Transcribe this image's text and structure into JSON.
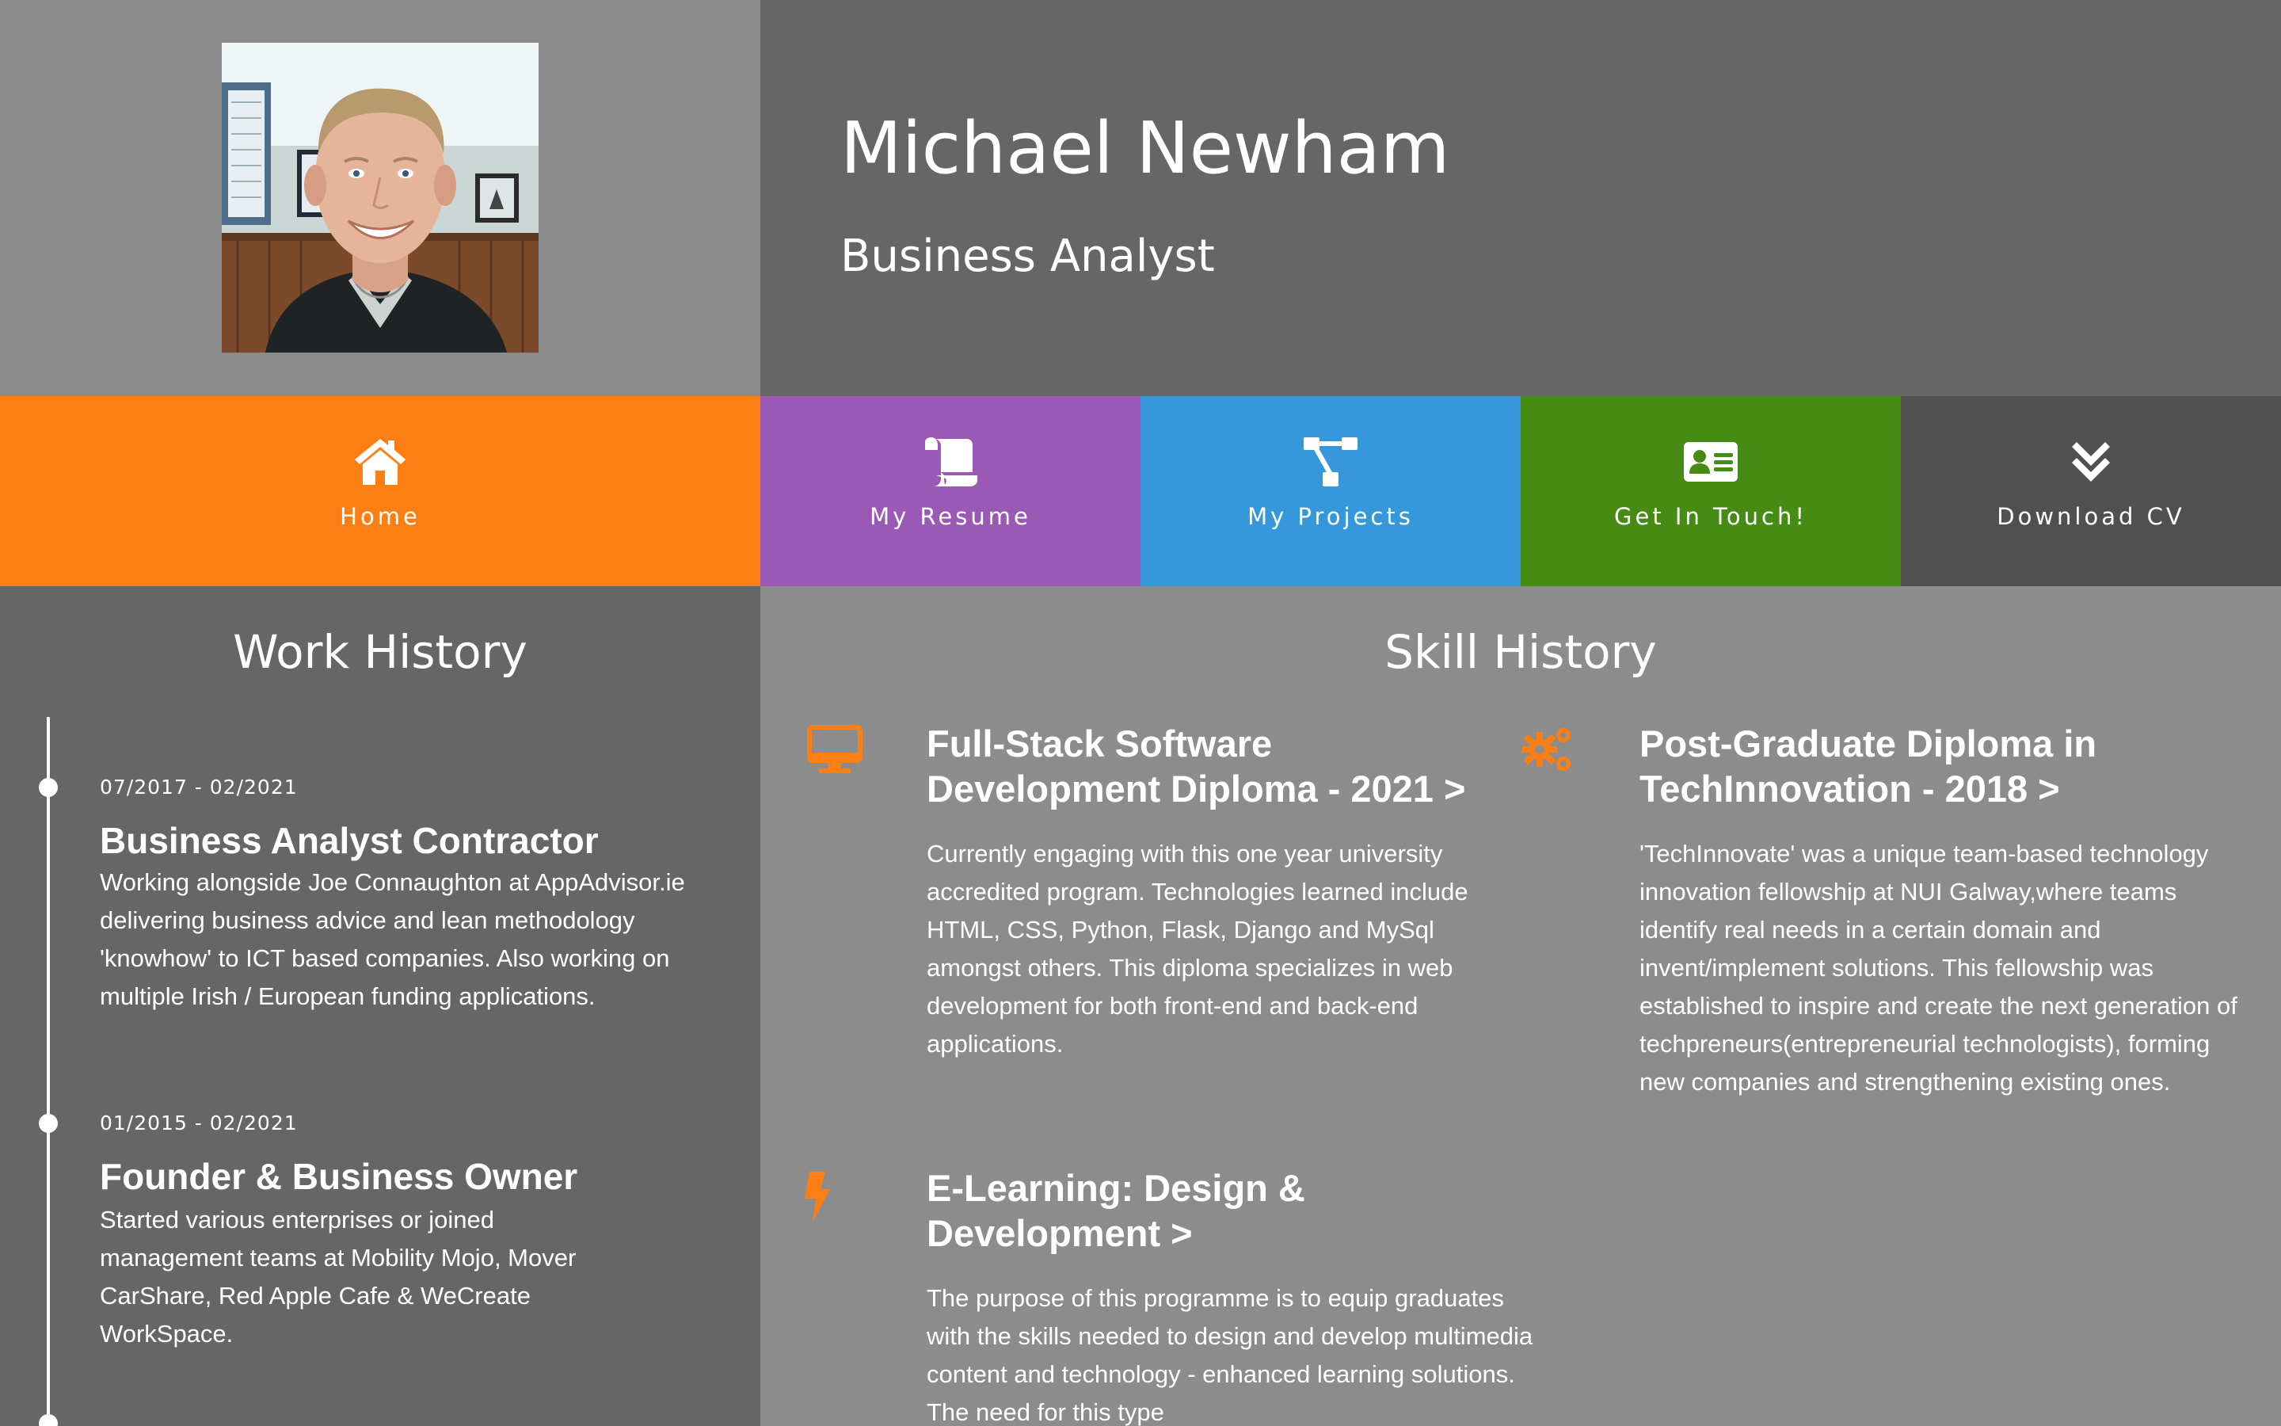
{
  "header": {
    "name": "Michael Newham",
    "job_title": "Business Analyst",
    "photo_icon": "profile-photo"
  },
  "nav": {
    "items": [
      {
        "label": "Home",
        "icon": "home-icon",
        "color": "#fd7f14"
      },
      {
        "label": "My Resume",
        "icon": "scroll-icon",
        "color": "#9b59b6"
      },
      {
        "label": "My Projects",
        "icon": "project-diagram-icon",
        "color": "#3498db"
      },
      {
        "label": "Get In Touch!",
        "icon": "address-card-icon",
        "color": "#468c14"
      },
      {
        "label": "Download CV",
        "icon": "angle-double-down-icon",
        "color": "#505050"
      }
    ]
  },
  "work_history": {
    "title": "Work History",
    "entries": [
      {
        "date": "07/2017 - 02/2021",
        "title": "Business Analyst Contractor",
        "description": "Working alongside Joe Connaughton at AppAdvisor.ie delivering business advice and lean methodology 'knowhow' to ICT based companies. Also working on multiple Irish / European funding applications."
      },
      {
        "date": "01/2015 - 02/2021",
        "title": "Founder & Business Owner",
        "description": "Started various enterprises or joined management teams at Mobility Mojo, Mover CarShare, Red Apple Cafe & WeCreate WorkSpace."
      }
    ]
  },
  "skill_history": {
    "title": "Skill History",
    "accent_color": "#fd7f14",
    "items": [
      {
        "icon": "desktop-icon",
        "title": "Full-Stack Software Development Diploma - 2021 >",
        "description": "Currently engaging with this one year university accredited program. Technologies learned include HTML, CSS, Python, Flask, Django and MySql amongst others. This diploma specializes in web development for both front-end and back-end applications."
      },
      {
        "icon": "cogs-icon",
        "title": "Post-Graduate Diploma in TechInnovation - 2018 >",
        "description": "'TechInnovate' was a unique team-based technology innovation fellowship at NUI Galway,where teams identify real needs in a certain domain and invent/implement solutions. This fellowship was established to inspire and create the next generation of techpreneurs(entrepreneurial technologists), forming new companies and strengthening existing ones."
      },
      {
        "icon": "bolt-icon",
        "title": "E-Learning: Design & Development >",
        "description": "The purpose of this programme is to equip graduates with the skills needed to design and develop multimedia content and technology - enhanced learning solutions. The need for this type"
      }
    ]
  }
}
